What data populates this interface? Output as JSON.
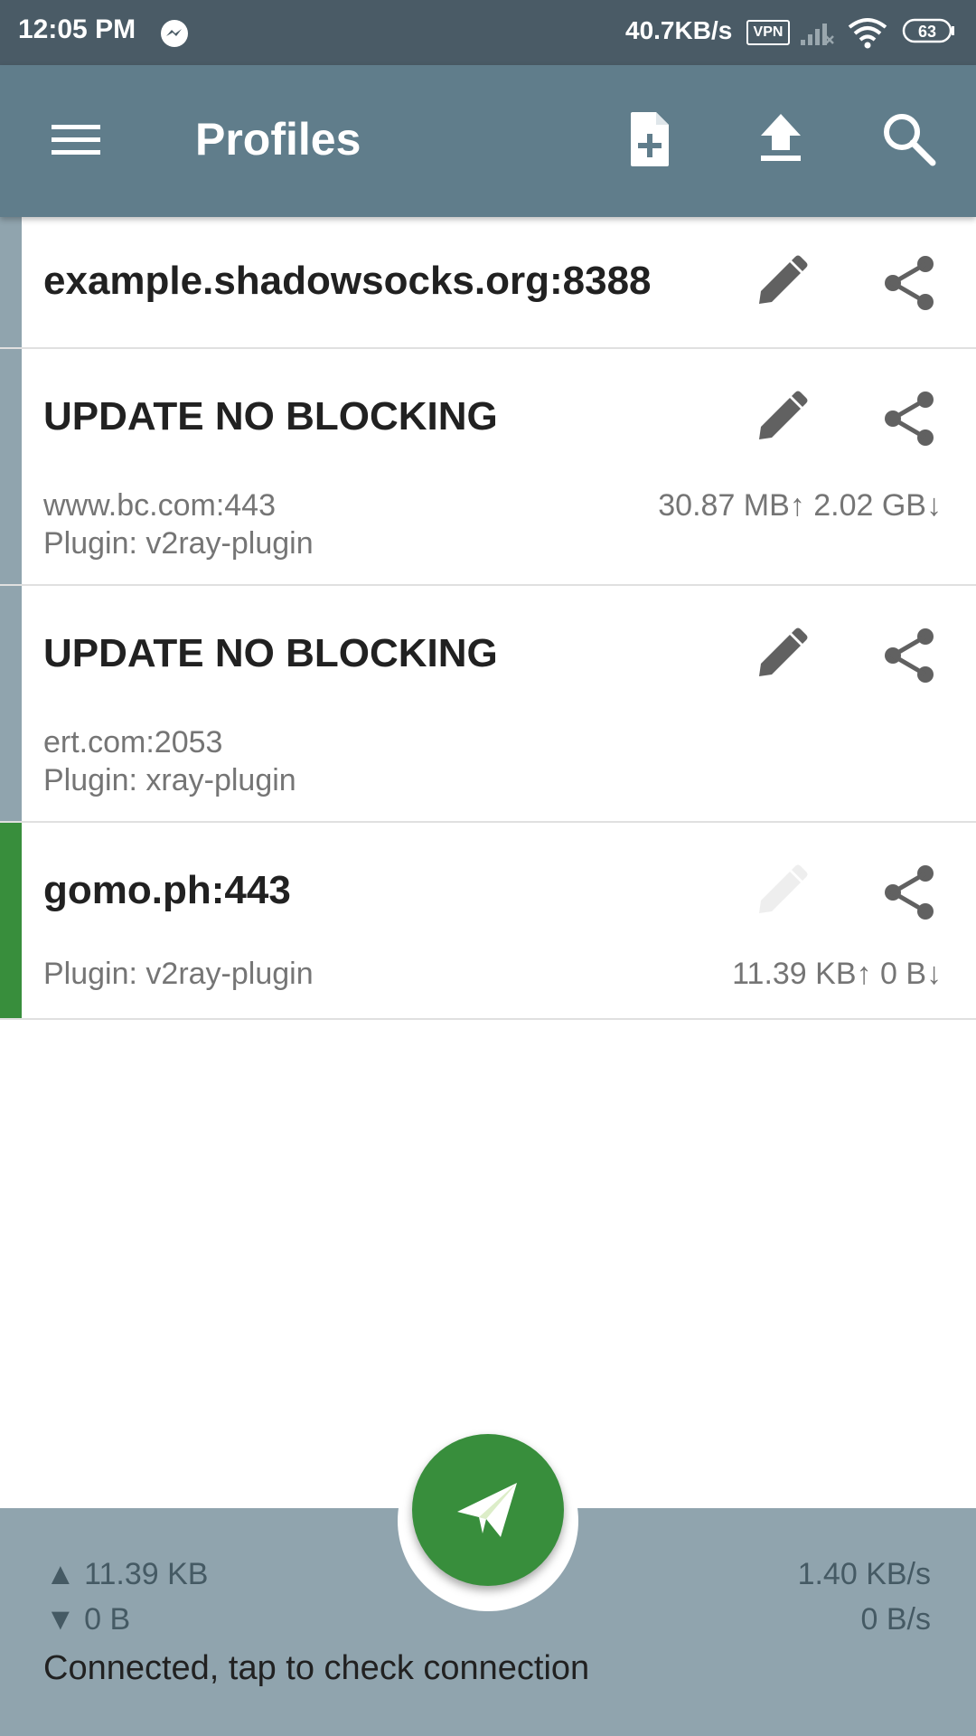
{
  "status_bar": {
    "time": "12:05 PM",
    "speed": "40.7KB/s",
    "vpn_label": "VPN",
    "battery": "63"
  },
  "toolbar": {
    "title": "Profiles",
    "icons": [
      "menu-icon",
      "add-file-icon",
      "upload-icon",
      "search-icon"
    ]
  },
  "profiles": [
    {
      "name": "example.shadowsocks.org:8388",
      "address": "",
      "plugin": "",
      "traffic": ""
    },
    {
      "name": "UPDATE NO BLOCKING",
      "address": "www.bc.com:443",
      "plugin": "Plugin: v2ray-plugin",
      "traffic": "30.87 MB↑ 2.02 GB↓"
    },
    {
      "name": "UPDATE NO BLOCKING",
      "address": "ert.com:2053",
      "plugin": "Plugin: xray-plugin",
      "traffic": ""
    },
    {
      "name": "gomo.ph:443",
      "address": "",
      "plugin": "Plugin: v2ray-plugin",
      "traffic": "11.39 KB↑  0 B↓",
      "selected": true
    }
  ],
  "bottom_bar": {
    "tx_total": "▲ 11.39 KB",
    "rx_total": "▼ 0 B",
    "tx_rate": "1.40 KB/s",
    "rx_rate": "0 B/s",
    "status": "Connected, tap to check connection"
  },
  "colors": {
    "toolbar": "#607d8b",
    "status_bar": "#4a5b66",
    "accent_connected": "#388e3c",
    "profile_strip": "#90a4ae",
    "bottom_bar": "#90a4ae"
  }
}
